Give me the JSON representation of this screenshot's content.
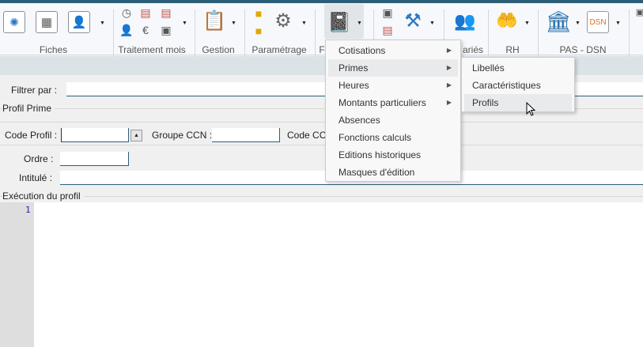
{
  "ribbon": {
    "groups": [
      {
        "label": "Fiches"
      },
      {
        "label": "Traitement mois"
      },
      {
        "label": "Gestion"
      },
      {
        "label": "Paramétrage"
      },
      {
        "label": "F"
      },
      {
        "label": "ariés"
      },
      {
        "label": "RH"
      },
      {
        "label": "PAS - DSN"
      }
    ],
    "dsn_icon_text": "DSN"
  },
  "menu": {
    "items": [
      {
        "label": "Cotisations",
        "submenu": true
      },
      {
        "label": "Primes",
        "submenu": true
      },
      {
        "label": "Heures",
        "submenu": true
      },
      {
        "label": "Montants particuliers",
        "submenu": true
      },
      {
        "label": "Absences"
      },
      {
        "label": "Fonctions calculs"
      },
      {
        "label": "Editions historiques"
      },
      {
        "label": "Masques d'édition"
      }
    ],
    "submenu": [
      {
        "label": "Libellés"
      },
      {
        "label": "Caractéristiques"
      },
      {
        "label": "Profils"
      }
    ]
  },
  "form": {
    "filter_label": "Filtrer par :",
    "filter_value": "",
    "section_profil": "Profil Prime",
    "code_profil_label": "Code Profil :",
    "code_profil_value": "",
    "groupe_ccn_label": "Groupe CCN :",
    "groupe_ccn_value": "",
    "code_ccn_label": "Code CCN",
    "ordre_label": "Ordre :",
    "ordre_value": "",
    "intitule_label": "Intitulé :",
    "intitule_value": "",
    "section_execution": "Exécution du profil",
    "line_number": "1"
  }
}
